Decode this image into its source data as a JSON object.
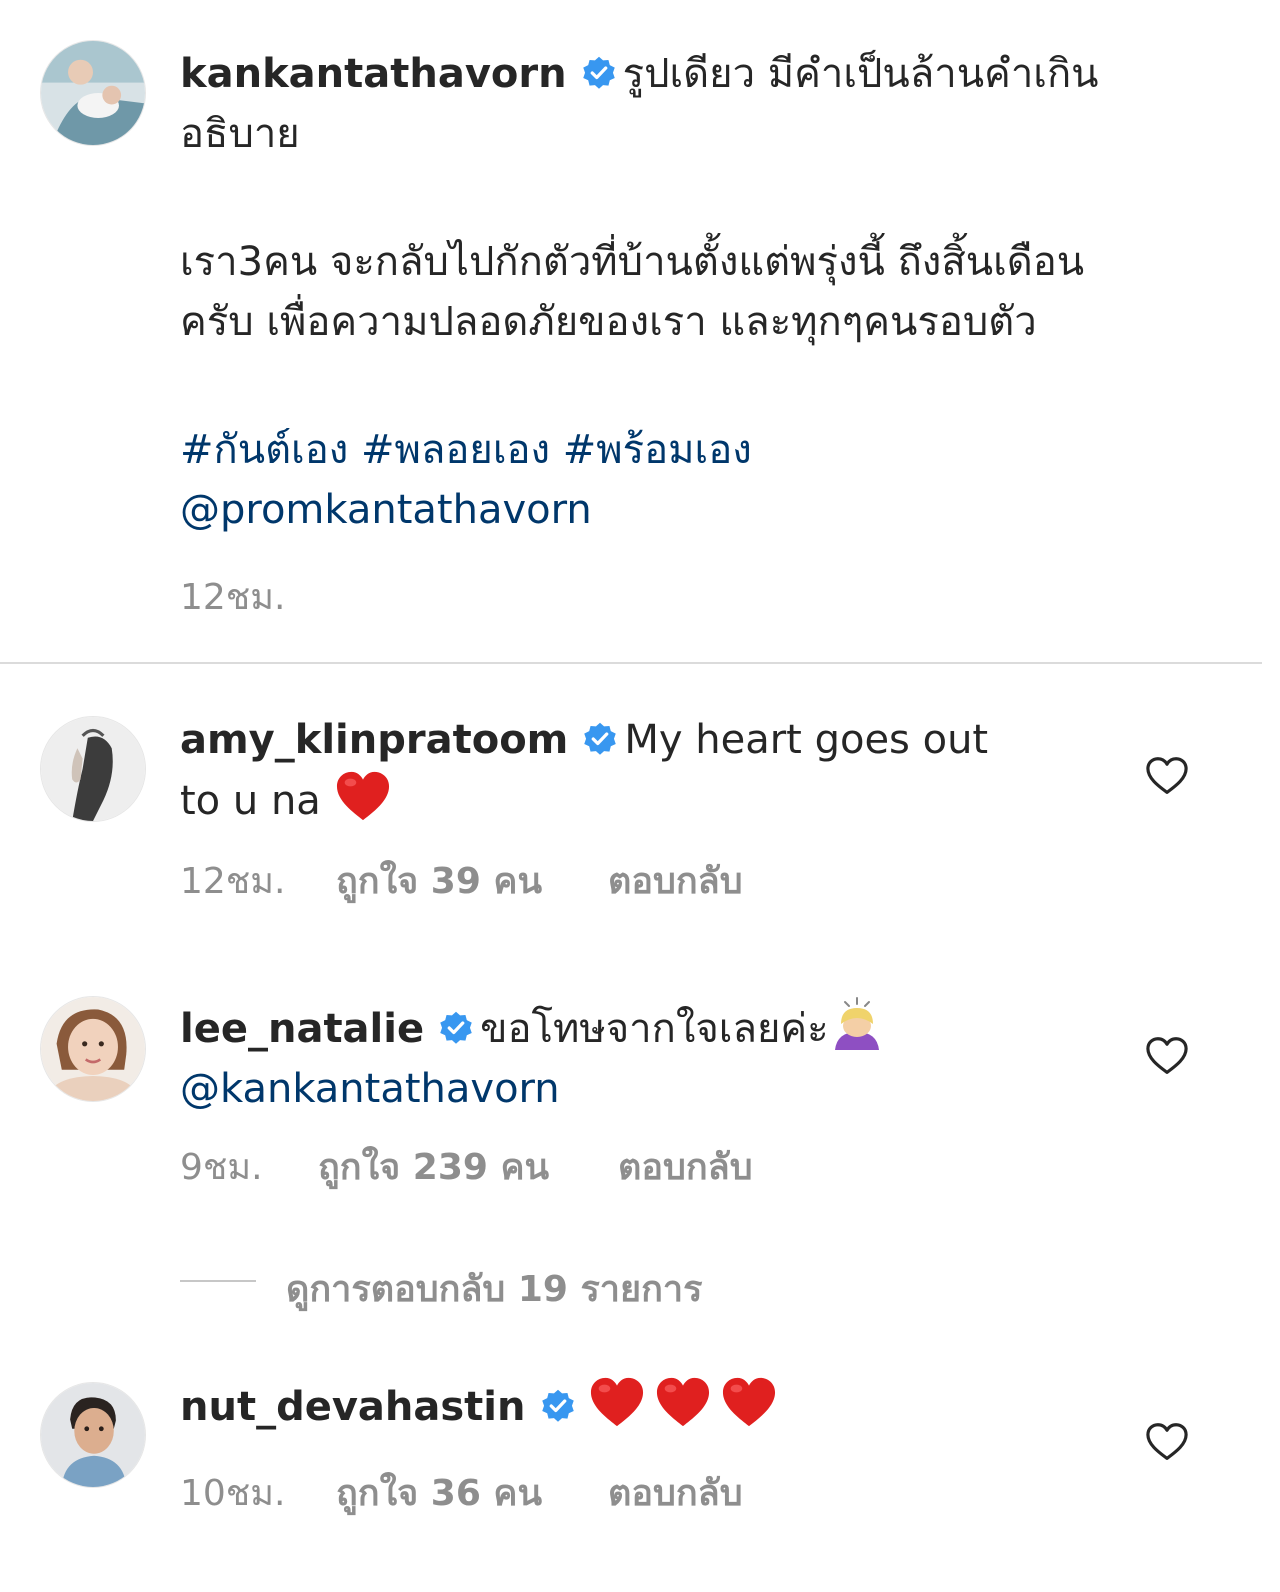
{
  "caption": {
    "username": "kankantathavorn",
    "text_line1": "รูปเดียว มีคำเป็นล้านคำเกิน",
    "text_line2": "อธิบาย",
    "text_line3": "เรา3คน จะกลับไปกักตัวที่บ้านตั้งแต่พรุ่งนี้ ถึงสิ้นเดือน",
    "text_line4": "ครับ เพื่อความปลอดภัยของเรา และทุกๆคนรอบตัว",
    "hashtags": "#กันต์เอง #พลอยเอง #พร้อมเอง",
    "mention": "@promkantathavorn",
    "time": "12ชม."
  },
  "comments": [
    {
      "username": "amy_klinpratoom",
      "text_line1": "My heart goes out",
      "text_line2": "to u na",
      "time": "12ชม.",
      "likes": "ถูกใจ 39 คน",
      "reply": "ตอบกลับ"
    },
    {
      "username": "lee_natalie",
      "text_line1": "ขอโทษจากใจเลยค่ะ",
      "mention": "@kankantathavorn",
      "time": "9ชม.",
      "likes": "ถูกใจ 239 คน",
      "reply": "ตอบกลับ"
    },
    {
      "username": "nut_devahastin",
      "time": "10ชม.",
      "likes": "ถูกใจ 36 คน",
      "reply": "ตอบกลับ"
    }
  ],
  "view_replies": "ดูการตอบกลับ 19 รายการ",
  "icons": {
    "verified": "verified-badge-icon",
    "like": "heart-outline-icon",
    "emoji_heart": "red-heart-emoji"
  },
  "colors": {
    "verified": "#3897f0",
    "link": "#00376b",
    "meta": "#8e8e8e",
    "emoji_heart": "#e0201f"
  }
}
